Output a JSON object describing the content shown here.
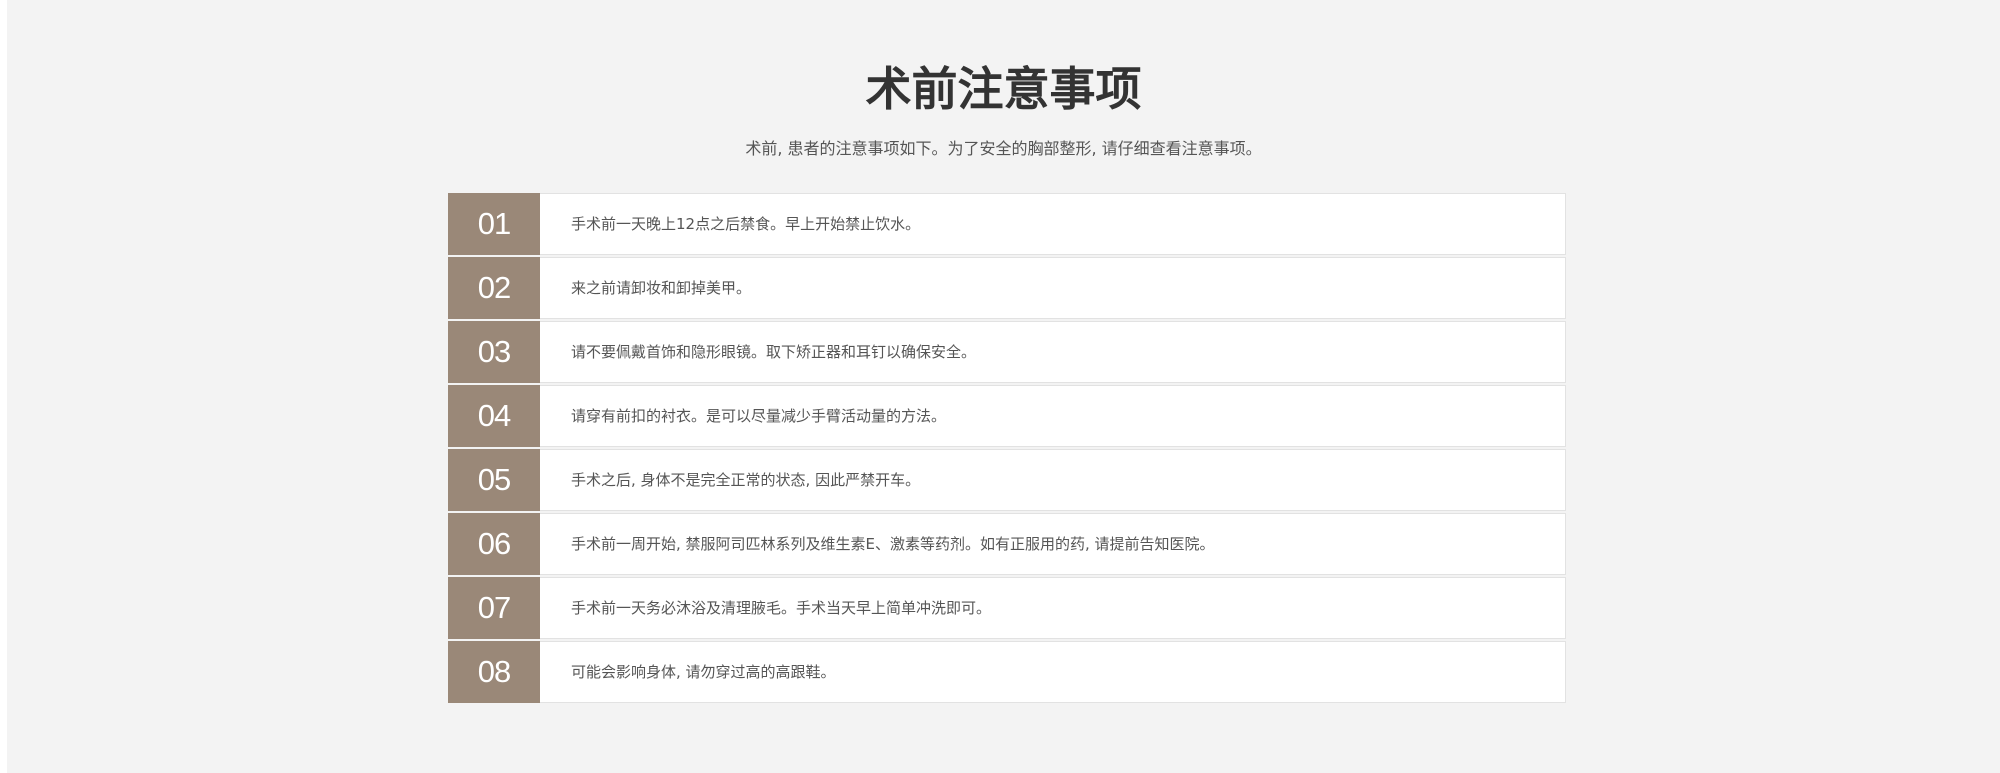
{
  "header": {
    "title": "术前注意事项",
    "subtitle": "术前, 患者的注意事项如下。为了安全的胸部整形, 请仔细查看注意事项。"
  },
  "items": [
    {
      "num": "01",
      "text": "手术前一天晚上12点之后禁食。早上开始禁止饮水。"
    },
    {
      "num": "02",
      "text": "来之前请卸妆和卸掉美甲。"
    },
    {
      "num": "03",
      "text": "请不要佩戴首饰和隐形眼镜。取下矫正器和耳钉以确保安全。"
    },
    {
      "num": "04",
      "text": "请穿有前扣的衬衣。是可以尽量减少手臂活动量的方法。"
    },
    {
      "num": "05",
      "text": "手术之后, 身体不是完全正常的状态, 因此严禁开车。"
    },
    {
      "num": "06",
      "text": "手术前一周开始, 禁服阿司匹林系列及维生素E、激素等药剂。如有正服用的药, 请提前告知医院。"
    },
    {
      "num": "07",
      "text": "手术前一天务必沐浴及清理腋毛。手术当天早上简单冲洗即可。"
    },
    {
      "num": "08",
      "text": "可能会影响身体, 请勿穿过高的高跟鞋。"
    }
  ],
  "colors": {
    "background": "#f3f3f3",
    "number_block": "#9a8878",
    "row_background": "#ffffff"
  }
}
